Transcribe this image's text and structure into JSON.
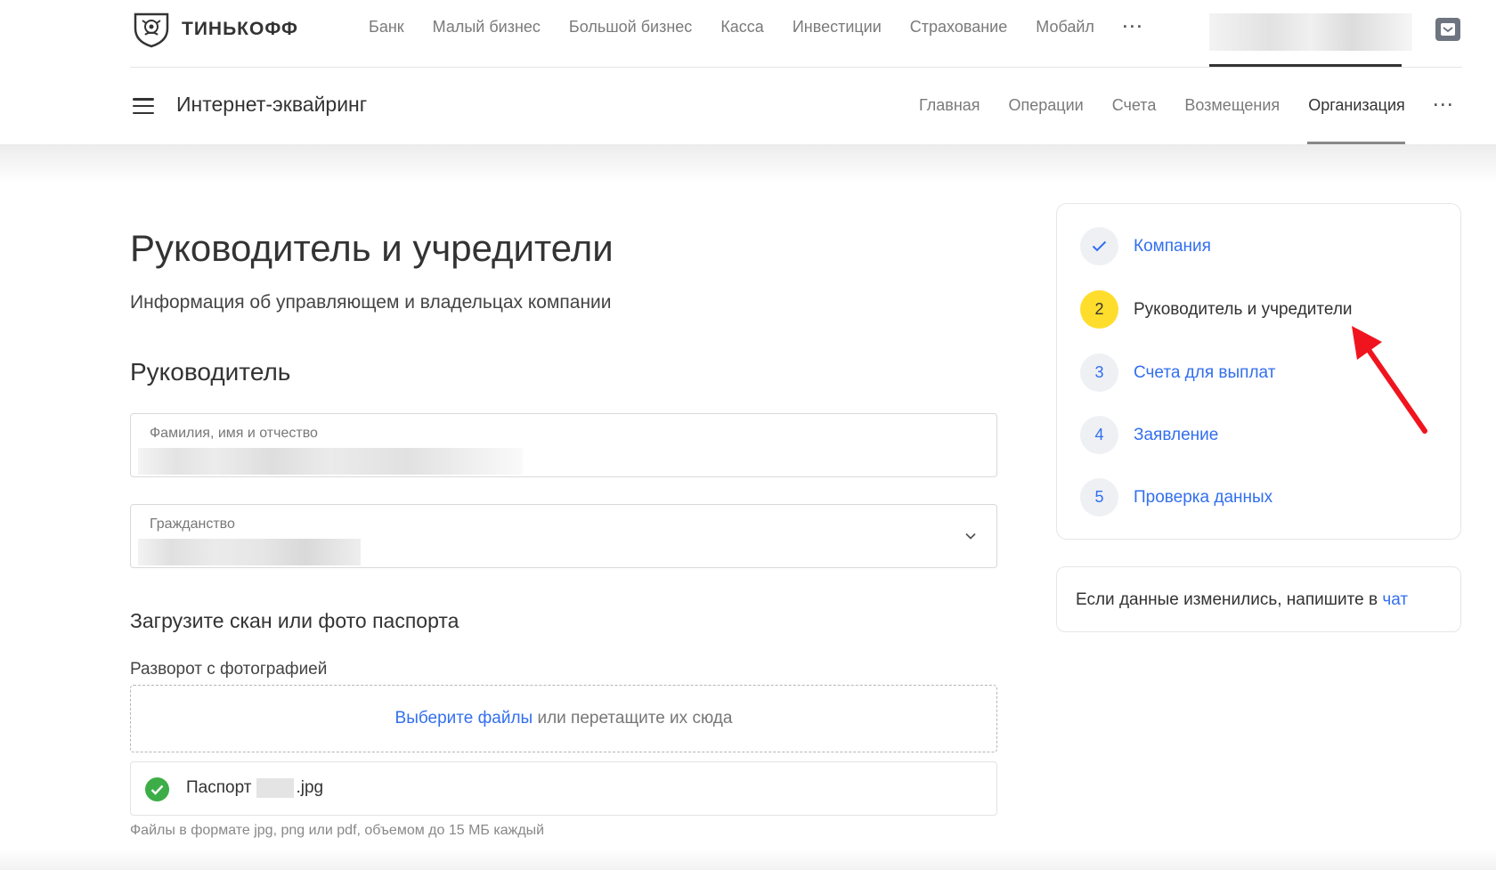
{
  "header": {
    "brand": "ТИНЬКОФФ",
    "nav": [
      "Банк",
      "Малый бизнес",
      "Большой бизнес",
      "Касса",
      "Инвестиции",
      "Страхование",
      "Мобайл"
    ],
    "more": "···"
  },
  "product": {
    "title": "Интернет-эквайринг",
    "nav": [
      "Главная",
      "Операции",
      "Счета",
      "Возмещения",
      "Организация"
    ],
    "active": "Организация",
    "more": "···"
  },
  "main": {
    "title": "Руководитель и учредители",
    "subtitle": "Информация об управляющем и владельцах компании",
    "section": "Руководитель",
    "fields": {
      "fio_label": "Фамилия, имя и отчество",
      "citizenship_label": "Гражданство"
    },
    "upload": {
      "title": "Загрузите скан или фото паспорта",
      "spread_label": "Разворот с фотографией",
      "choose_link": "Выберите файлы",
      "drop_text": " или перетащите их сюда",
      "file_prefix": "Паспорт",
      "file_suffix": ".jpg",
      "hint": "Файлы в формате jpg, png или pdf, объемом до 15 МБ каждый"
    }
  },
  "steps": [
    {
      "num": "",
      "label": "Компания",
      "state": "done"
    },
    {
      "num": "2",
      "label": "Руководитель и учредители",
      "state": "current"
    },
    {
      "num": "3",
      "label": "Счета для выплат",
      "state": "todo"
    },
    {
      "num": "4",
      "label": "Заявление",
      "state": "todo"
    },
    {
      "num": "5",
      "label": "Проверка данных",
      "state": "todo"
    }
  ],
  "info": {
    "text": "Если данные изменились, напишите в ",
    "link": "чат"
  },
  "colors": {
    "accent_link": "#336fee",
    "current_step": "#ffdd2d",
    "success": "#3dae47",
    "annotation_arrow": "#f0141e"
  }
}
